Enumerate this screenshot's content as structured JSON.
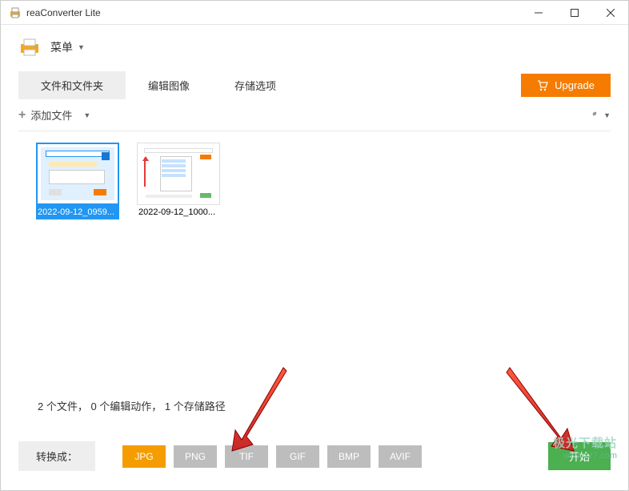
{
  "window": {
    "title": "reaConverter Lite"
  },
  "menu": {
    "label": "菜单"
  },
  "tabs": {
    "files": "文件和文件夹",
    "edit": "编辑图像",
    "save": "存储选项",
    "upgrade": "Upgrade"
  },
  "toolbar": {
    "add_files": "添加文件"
  },
  "thumbnails": [
    {
      "caption": "2022-09-12_0959...",
      "selected": true
    },
    {
      "caption": "2022-09-12_1000...",
      "selected": false
    }
  ],
  "status": "2 个文件， 0 个编辑动作， 1 个存储路径",
  "convert": {
    "label": "转换成：",
    "formats": [
      "JPG",
      "PNG",
      "TIF",
      "GIF",
      "BMP",
      "AVIF"
    ],
    "active": "JPG",
    "start": "开始"
  },
  "watermark": {
    "line1": "极光下载站",
    "line2": "www.xz7.com"
  }
}
